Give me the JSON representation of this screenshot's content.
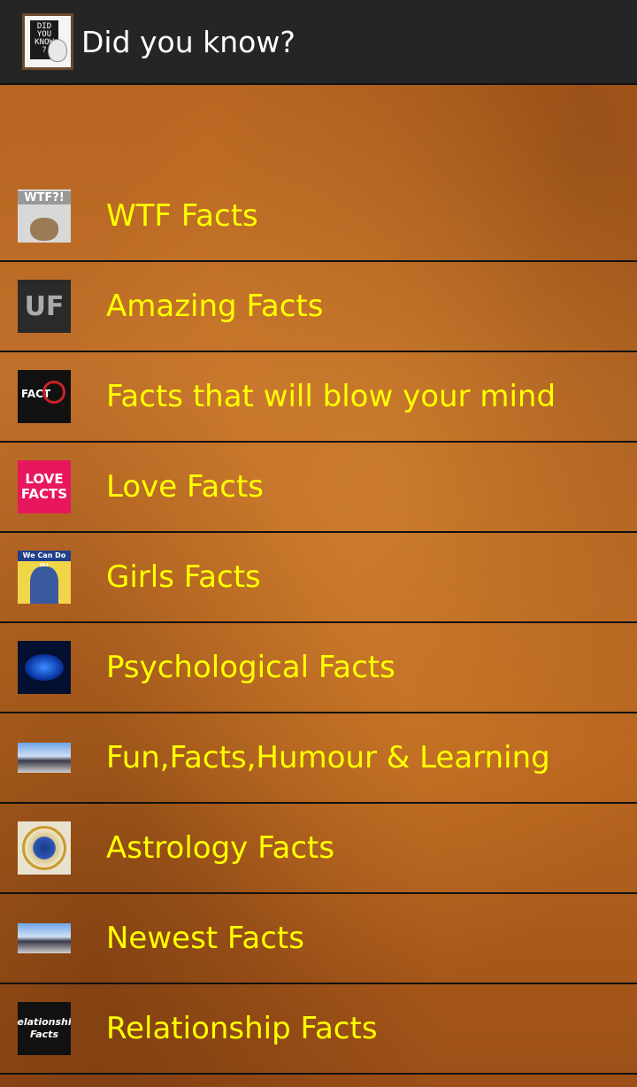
{
  "app": {
    "title": "Did you know?",
    "icon": "did-you-know-chalkboard-icon",
    "icon_text": "DID YOU KNOW ?"
  },
  "colors": {
    "actionbar": "#252525",
    "label": "#ffff00",
    "divider": "#111111",
    "background": "#b5621e"
  },
  "items": [
    {
      "label": "WTF Facts",
      "icon": "wtf-owl-icon",
      "thumb_text": "WTF?!"
    },
    {
      "label": "Amazing Facts",
      "icon": "uf-logo-icon",
      "thumb_text": "UF"
    },
    {
      "label": "Facts that will blow your mind",
      "icon": "fact-logo-icon",
      "thumb_text": "FACT"
    },
    {
      "label": "Love Facts",
      "icon": "love-facts-icon",
      "thumb_text": "LOVE FACTS"
    },
    {
      "label": "Girls Facts",
      "icon": "we-can-do-it-icon",
      "thumb_text": "We Can Do It!"
    },
    {
      "label": "Psychological Facts",
      "icon": "brain-icon"
    },
    {
      "label": "Fun,Facts,Humour & Learning",
      "icon": "crowd-photo-icon"
    },
    {
      "label": "Astrology Facts",
      "icon": "zodiac-wheel-icon"
    },
    {
      "label": "Newest Facts",
      "icon": "crowd-photo-icon"
    },
    {
      "label": "Relationship Facts",
      "icon": "relationship-facts-icon",
      "thumb_text": "Relationship Facts"
    }
  ]
}
